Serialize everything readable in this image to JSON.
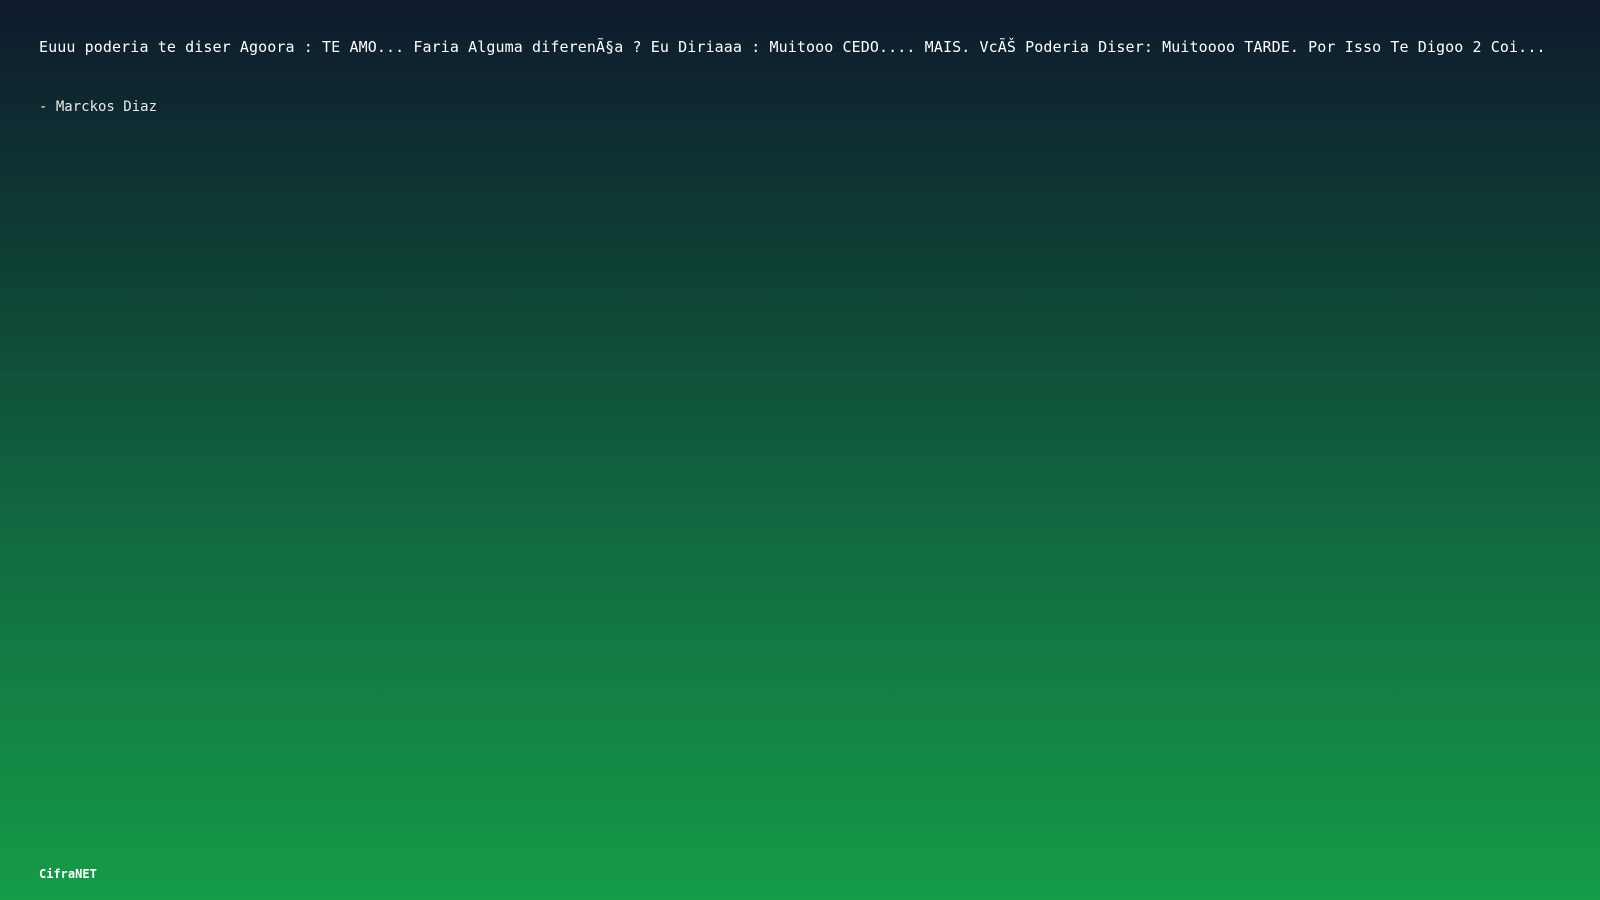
{
  "quote": {
    "text": "Euuu poderia te diser Agoora : TE AMO... Faria Alguma diferenÃ§a ? Eu Diriaaa : Muitooo CEDO.... MAIS. VcÃŠ Poderia Diser: Muitoooo TARDE. Por Isso Te Digoo 2 Coi...",
    "author": "- Marckos Diaz"
  },
  "footer": {
    "brand": "CifraNET"
  },
  "colors": {
    "gradient_top": "#0f1a2e",
    "gradient_bottom": "#159c47",
    "text": "#ffffff"
  }
}
